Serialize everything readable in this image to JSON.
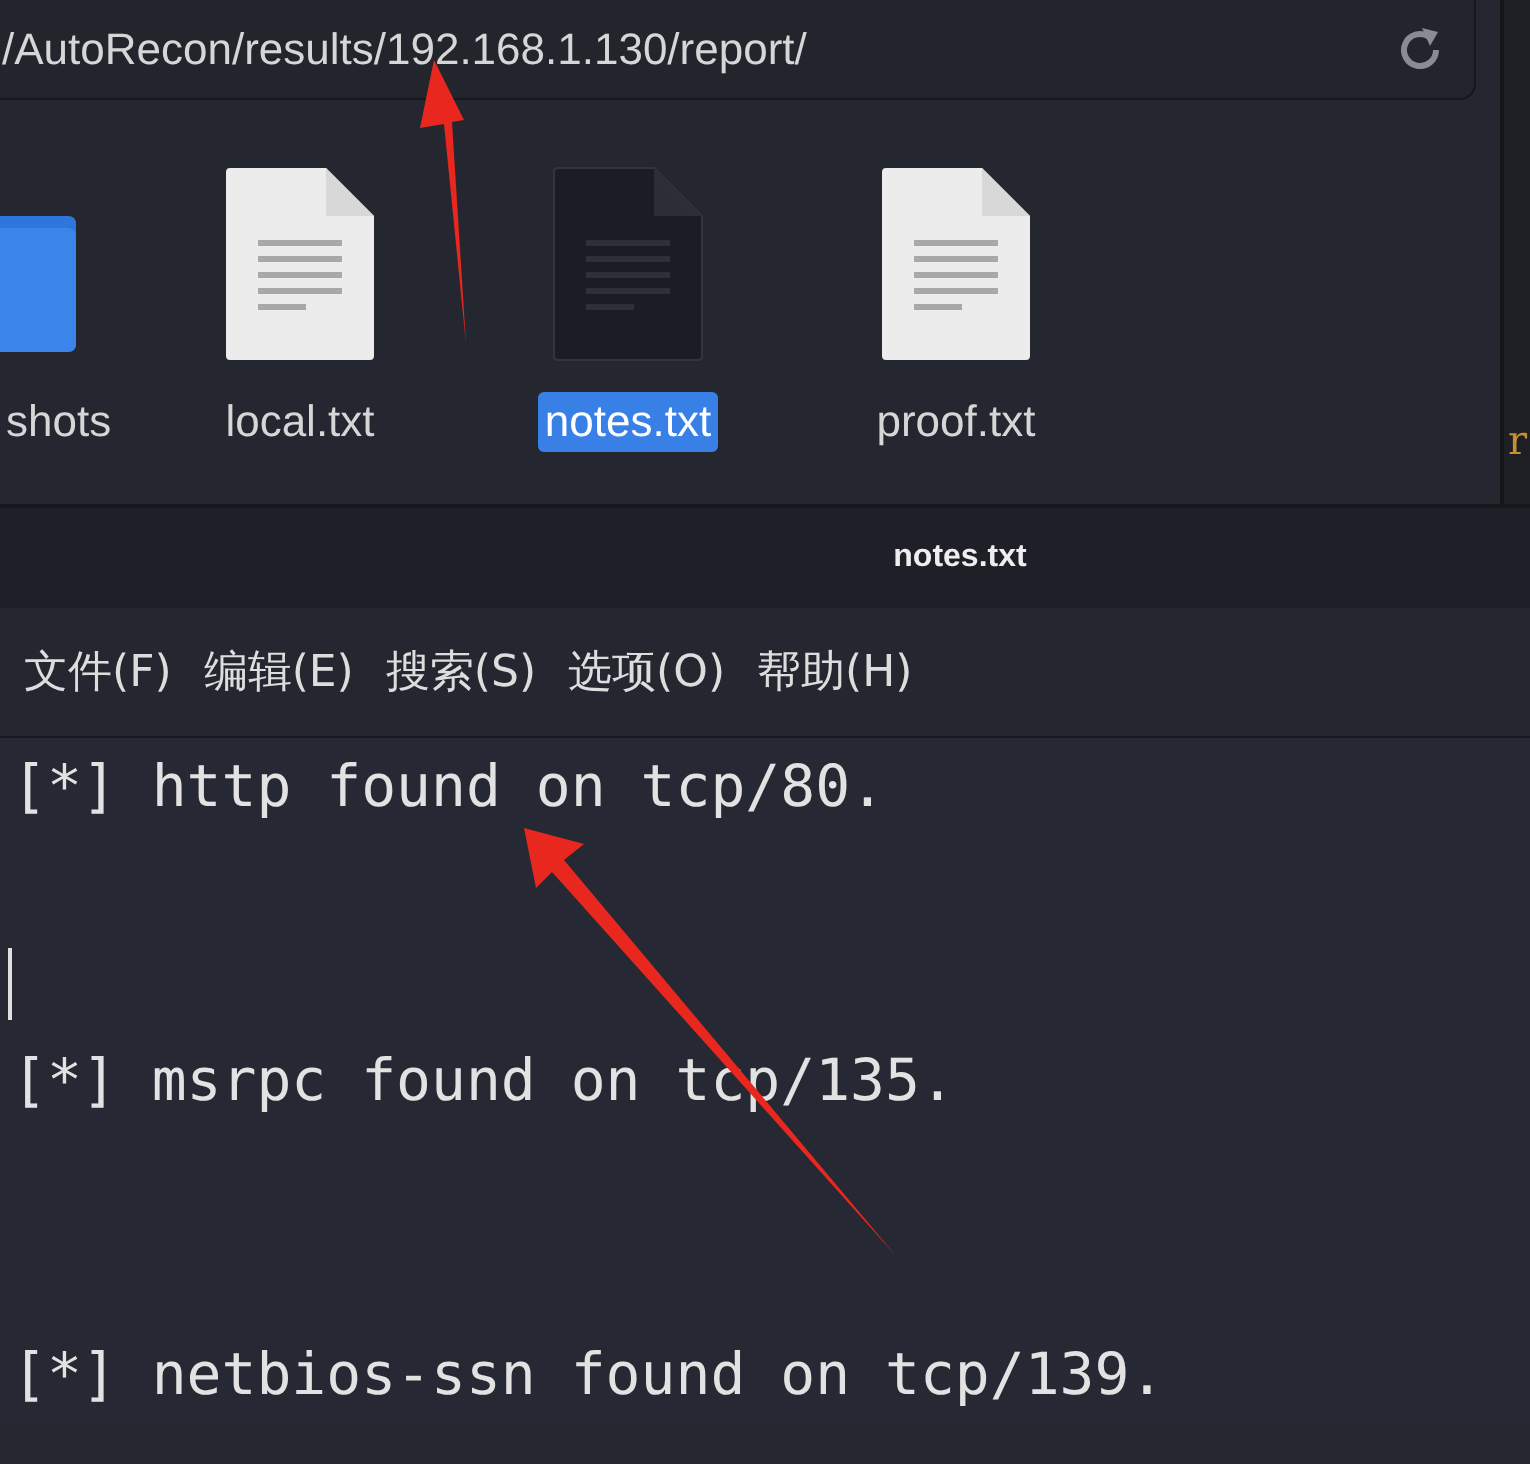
{
  "location_bar": {
    "path": "/AutoRecon/results/192.168.1.130/report/"
  },
  "files": [
    {
      "name": "shots",
      "kind": "folder",
      "selected": false
    },
    {
      "name": "local.txt",
      "kind": "file",
      "selected": false
    },
    {
      "name": "notes.txt",
      "kind": "file",
      "selected": true
    },
    {
      "name": "proof.txt",
      "kind": "file",
      "selected": false
    }
  ],
  "side_text": "r",
  "editor": {
    "title": "notes.txt",
    "menu": [
      "文件(F)",
      "编辑(E)",
      "搜索(S)",
      "选项(O)",
      "帮助(H)"
    ],
    "lines": [
      {
        "kind": "text",
        "text": "[*] http found on tcp/80."
      },
      {
        "kind": "cursor"
      },
      {
        "kind": "text",
        "text": "[*] msrpc found on tcp/135."
      },
      {
        "kind": "text",
        "text": "[*] netbios-ssn found on tcp/139."
      }
    ]
  }
}
